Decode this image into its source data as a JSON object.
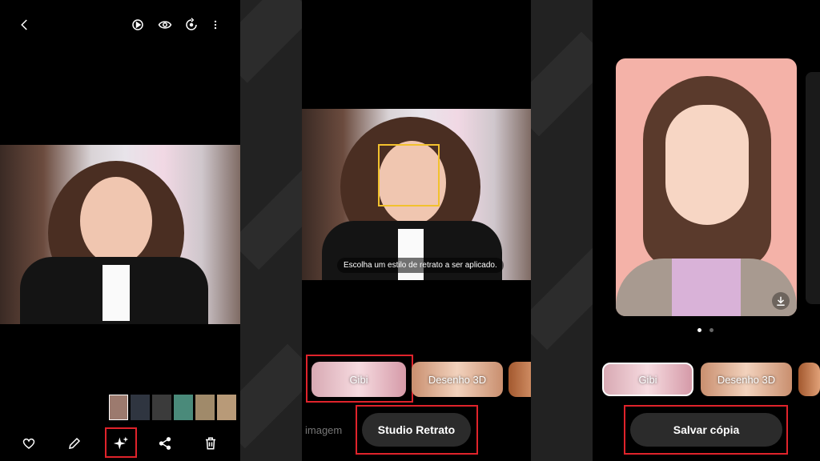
{
  "panel2": {
    "toast": "Escolha um estilo de retrato a ser aplicado.",
    "styles": [
      {
        "label": "Gibi"
      },
      {
        "label": "Desenho 3D"
      }
    ],
    "left_tab": "imagem",
    "action_button": "Studio Retrato"
  },
  "panel3": {
    "styles": [
      {
        "label": "Gibi"
      },
      {
        "label": "Desenho 3D"
      }
    ],
    "action_button": "Salvar cópia",
    "page_dots": {
      "count": 2,
      "active": 1
    }
  },
  "colors": {
    "highlight": "#e0232b",
    "face_box": "#f2c12e",
    "panel_bg": "#000000",
    "pill_bg": "#2b2b2b"
  }
}
